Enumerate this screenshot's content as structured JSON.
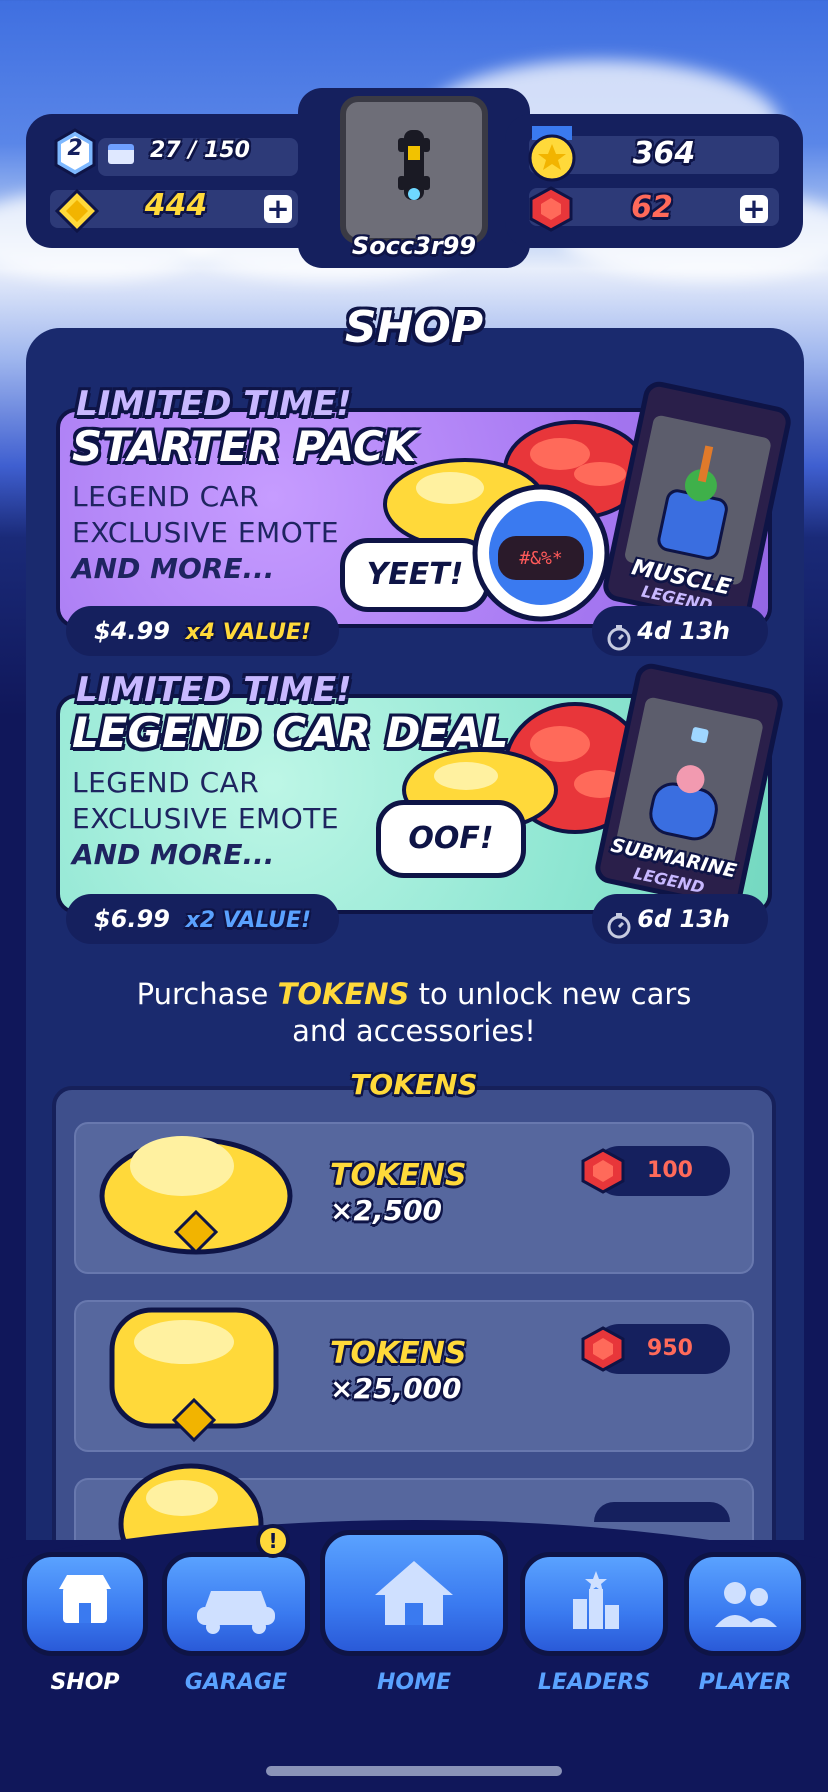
{
  "hud": {
    "level": "2",
    "xp_progress": "27 / 150",
    "tokens": "444",
    "username": "Socc3r99",
    "stars": "364",
    "gems": "62",
    "plus_label": "+"
  },
  "shop": {
    "title": "SHOP",
    "deals": [
      {
        "limited_label": "LIMITED TIME!",
        "title": "STARTER PACK",
        "line1": "LEGEND CAR",
        "line2": "EXCLUSIVE EMOTE",
        "line3": "AND MORE...",
        "price": "$4.99",
        "value": "x4 VALUE!",
        "timer": "4d 13h",
        "emote": "YEET!",
        "card_name": "MUSCLE",
        "card_rarity": "LEGEND",
        "helmet_text": "#&%*"
      },
      {
        "limited_label": "LIMITED TIME!",
        "title": "LEGEND CAR DEAL",
        "line1": "LEGEND CAR",
        "line2": "EXCLUSIVE EMOTE",
        "line3": "AND MORE...",
        "price": "$6.99",
        "value": "x2 VALUE!",
        "timer": "6d 13h",
        "emote": "OOF!",
        "card_name": "SUBMARINE",
        "card_rarity": "LEGEND"
      }
    ],
    "purchase_prefix": "Purchase ",
    "purchase_highlight": "TOKENS",
    "purchase_suffix": " to unlock new cars",
    "purchase_line2": "and accessories!",
    "tokens_header": "TOKENS",
    "token_items": [
      {
        "label": "TOKENS",
        "amount": "×2,500",
        "cost": "100"
      },
      {
        "label": "TOKENS",
        "amount": "×25,000",
        "cost": "950"
      }
    ]
  },
  "nav": {
    "items": [
      {
        "label": "SHOP"
      },
      {
        "label": "GARAGE"
      },
      {
        "label": "HOME"
      },
      {
        "label": "LEADERS"
      },
      {
        "label": "PLAYER"
      }
    ],
    "garage_badge": "!"
  },
  "colors": {
    "accent_yellow": "#ffd93a",
    "gem_red": "#e8363a",
    "nav_blue": "#3a7af0",
    "panel_navy": "#15205e"
  }
}
